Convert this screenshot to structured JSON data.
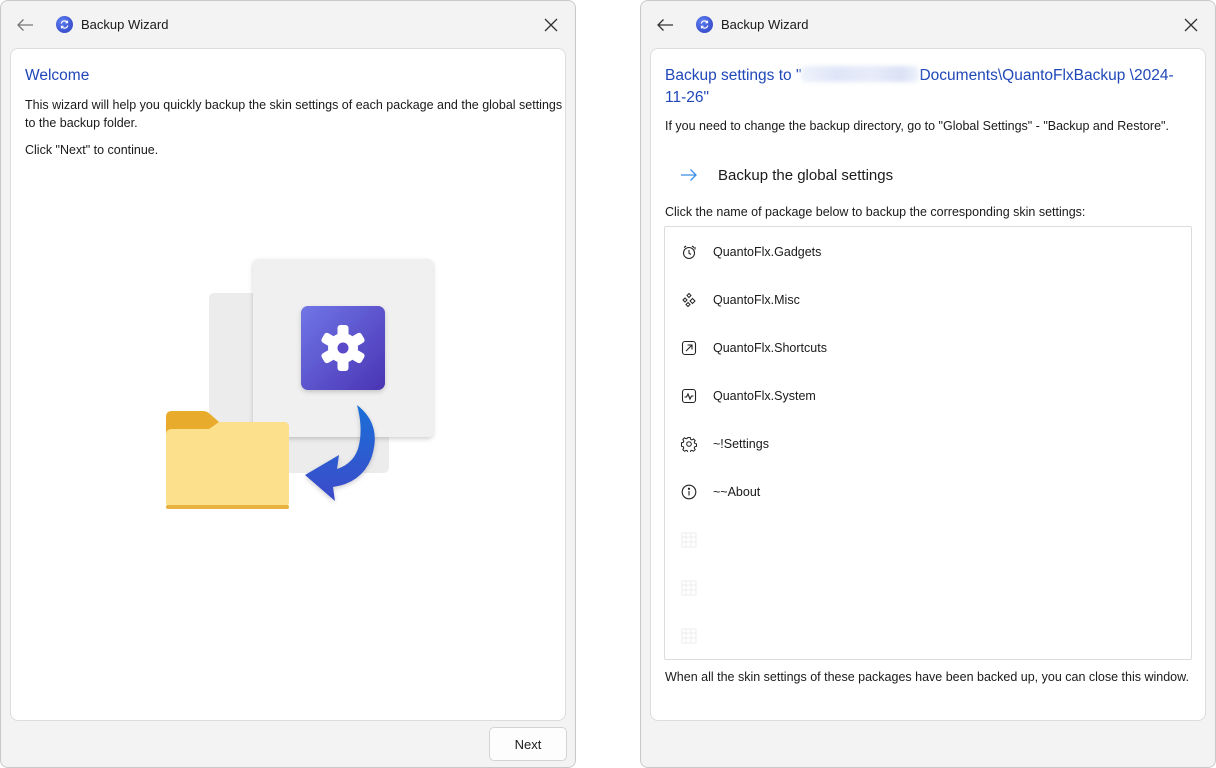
{
  "left_window": {
    "title": "Backup Wizard",
    "heading": "Welcome",
    "description": "This wizard will help you quickly backup the skin settings of each package and the global settings to the backup folder.",
    "continue_hint": "Click \"Next\" to continue.",
    "next_label": "Next",
    "illustration": "settings-to-folder-backup"
  },
  "right_window": {
    "title": "Backup Wizard",
    "heading_prefix": "Backup settings to \"",
    "heading_path_visible": "Documents\\QuantoFlxBackup \\2024-11-26\"",
    "heading_redacted": "[blurred path]",
    "note": "If you need to change the backup directory, go to \"Global Settings\" - \"Backup and Restore\".",
    "global_link_label": "Backup the global settings",
    "package_instruction": "Click the name of package below to backup the corresponding skin settings:",
    "packages": [
      {
        "name": "QuantoFlx.Gadgets",
        "icon": "clock-icon"
      },
      {
        "name": "QuantoFlx.Misc",
        "icon": "sparkle-diamonds-icon"
      },
      {
        "name": "QuantoFlx.Shortcuts",
        "icon": "open-arrow-icon"
      },
      {
        "name": "QuantoFlx.System",
        "icon": "pulse-icon"
      },
      {
        "name": "~!Settings",
        "icon": "gear-icon"
      },
      {
        "name": "~~About",
        "icon": "info-icon"
      },
      {
        "name": "",
        "icon": "placeholder-icon"
      },
      {
        "name": "",
        "icon": "placeholder-icon"
      },
      {
        "name": "",
        "icon": "placeholder-icon"
      }
    ],
    "footer": "When all the skin settings of these packages have been backed up, you can close this window."
  },
  "colors": {
    "accent": "#1f47b8",
    "link_arrow": "#3b8fe8",
    "window_bg": "#f3f3f3",
    "card_bg": "#ffffff"
  }
}
